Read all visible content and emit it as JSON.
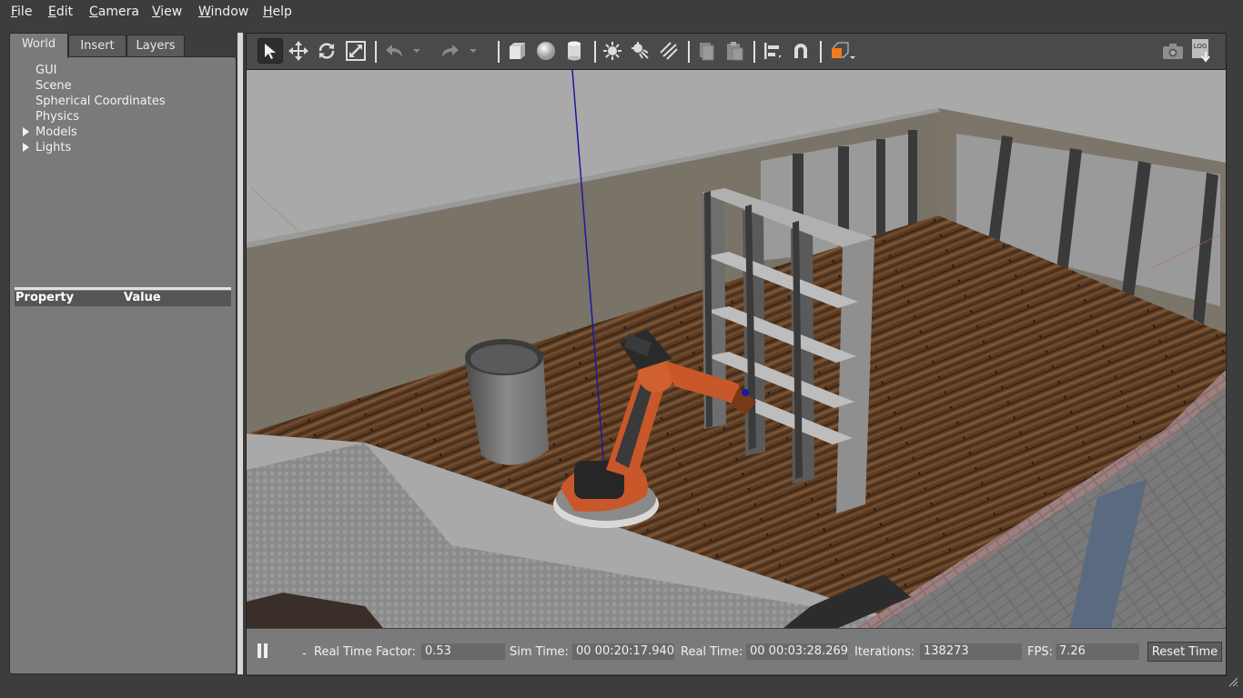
{
  "menu": {
    "file": {
      "first": "F",
      "rest": "ile"
    },
    "edit": {
      "first": "E",
      "rest": "dit"
    },
    "camera": {
      "first": "C",
      "rest": "amera"
    },
    "view": {
      "first": "V",
      "rest": "iew"
    },
    "window": {
      "first": "W",
      "rest": "indow"
    },
    "help": {
      "first": "H",
      "rest": "elp"
    }
  },
  "left_panel": {
    "tabs": [
      "World",
      "Insert",
      "Layers"
    ],
    "active_tab": "World",
    "tree": [
      "GUI",
      "Scene",
      "Spherical Coordinates",
      "Physics",
      "Models",
      "Lights"
    ],
    "property_header": {
      "property": "Property",
      "value": "Value"
    }
  },
  "toolbar": {
    "icons": [
      "select-arrow-icon",
      "translate-icon",
      "rotate-icon",
      "scale-icon",
      "undo-icon",
      "undo-history-icon",
      "redo-icon",
      "redo-history-icon",
      "box-icon",
      "sphere-icon",
      "cylinder-icon",
      "point-light-icon",
      "spot-light-icon",
      "directional-light-icon",
      "copy-icon",
      "paste-icon",
      "align-icon",
      "snap-magnet-icon",
      "view-angle-icon",
      "screenshot-icon",
      "log-icon"
    ],
    "log_text": "LOG"
  },
  "status": {
    "real_time_factor_label": "Real Time Factor:",
    "real_time_factor": "0.53",
    "sim_time_label": "Sim Time:",
    "sim_time": "00 00:20:17.940",
    "real_time_label": "Real Time:",
    "real_time": "00 00:03:28.269",
    "iterations_label": "Iterations:",
    "iterations": "138273",
    "fps_label": "FPS:",
    "fps": "7.26",
    "reset_label": "Reset Time",
    "step_marker": "-"
  },
  "colors": {
    "robot_orange": "#c8572a",
    "floor_wood": "#5a3a22",
    "selected_tool_bg": "#2e2e2e",
    "view_angle_orange": "#f07c1e"
  }
}
